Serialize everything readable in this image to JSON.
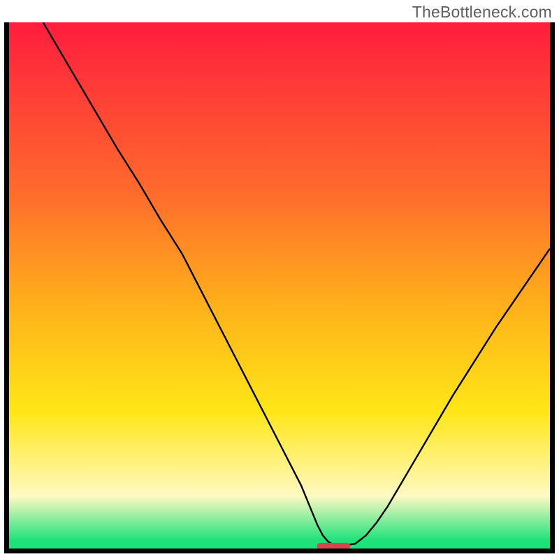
{
  "watermark": "TheBottleneck.com",
  "colors": {
    "grad_top": "#ff1d3e",
    "grad_mid1": "#ff6a2c",
    "grad_mid2": "#ffb41a",
    "grad_mid3": "#ffe617",
    "grad_pale": "#fff9c2",
    "grad_green": "#1de27a",
    "axis": "#000000",
    "curve": "#000000",
    "marker_fill": "#d6464d",
    "marker_stroke": "#d6464d"
  },
  "chart_data": {
    "type": "line",
    "title": "",
    "xlabel": "",
    "ylabel": "",
    "xlim": [
      0,
      100
    ],
    "ylim": [
      0,
      100
    ],
    "series": [
      {
        "name": "bottleneck-curve",
        "x": [
          0,
          4,
          8,
          12,
          16,
          20,
          24,
          28,
          32,
          34,
          36,
          38,
          40,
          42,
          44,
          46,
          48,
          50,
          52,
          54,
          56,
          57,
          58,
          59,
          60,
          62,
          64,
          66,
          68,
          70,
          74,
          78,
          82,
          86,
          90,
          94,
          98,
          100
        ],
        "y": [
          111,
          104,
          97,
          90,
          83,
          76,
          69.5,
          62.5,
          56,
          52,
          48,
          44,
          40,
          36,
          32,
          28,
          24,
          20,
          16,
          12,
          7,
          4.5,
          2.5,
          1.3,
          0.7,
          0.6,
          0.9,
          2.5,
          5,
          8,
          15,
          22,
          29,
          35.5,
          42,
          48,
          54,
          57
        ]
      }
    ],
    "marker": {
      "x_center": 60,
      "x_half_width": 3
    },
    "gradient_stops": [
      {
        "offset": 0.0,
        "color_key": "grad_top"
      },
      {
        "offset": 0.32,
        "color_key": "grad_mid1"
      },
      {
        "offset": 0.55,
        "color_key": "grad_mid2"
      },
      {
        "offset": 0.74,
        "color_key": "grad_mid3"
      },
      {
        "offset": 0.9,
        "color_key": "grad_pale"
      },
      {
        "offset": 0.985,
        "color_key": "grad_green"
      }
    ]
  }
}
